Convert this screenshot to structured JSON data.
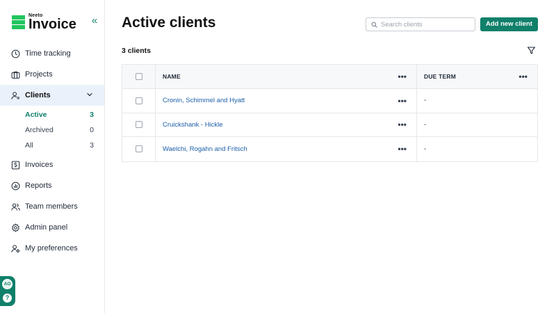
{
  "brand": {
    "small": "Neeto",
    "big": "Invoice",
    "color": "#22c55e",
    "accent": "#10806a"
  },
  "sidebar": {
    "items": [
      {
        "label": "Time tracking",
        "icon": "clock-icon"
      },
      {
        "label": "Projects",
        "icon": "briefcase-icon"
      },
      {
        "label": "Clients",
        "icon": "client-icon",
        "selected": true
      },
      {
        "label": "Invoices",
        "icon": "invoice-icon"
      },
      {
        "label": "Reports",
        "icon": "reports-icon"
      },
      {
        "label": "Team members",
        "icon": "team-icon"
      },
      {
        "label": "Admin panel",
        "icon": "settings-icon"
      },
      {
        "label": "My preferences",
        "icon": "user-settings-icon"
      }
    ],
    "subitems": [
      {
        "label": "Active",
        "count": "3",
        "active": true
      },
      {
        "label": "Archived",
        "count": "0"
      },
      {
        "label": "All",
        "count": "3"
      }
    ],
    "avatar_initials": "AO",
    "help_label": "?"
  },
  "header": {
    "title": "Active clients",
    "search_placeholder": "Search clients",
    "add_button": "Add new client"
  },
  "count_label": "3 clients",
  "table": {
    "columns": [
      "NAME",
      "DUE TERM"
    ],
    "rows": [
      {
        "name": "Cronin, Schimmel and Hyatt",
        "due_term": "-"
      },
      {
        "name": "Cruickshank - Hickle",
        "due_term": "-"
      },
      {
        "name": "Waelchi, Rogahn and Fritsch",
        "due_term": "-"
      }
    ]
  }
}
